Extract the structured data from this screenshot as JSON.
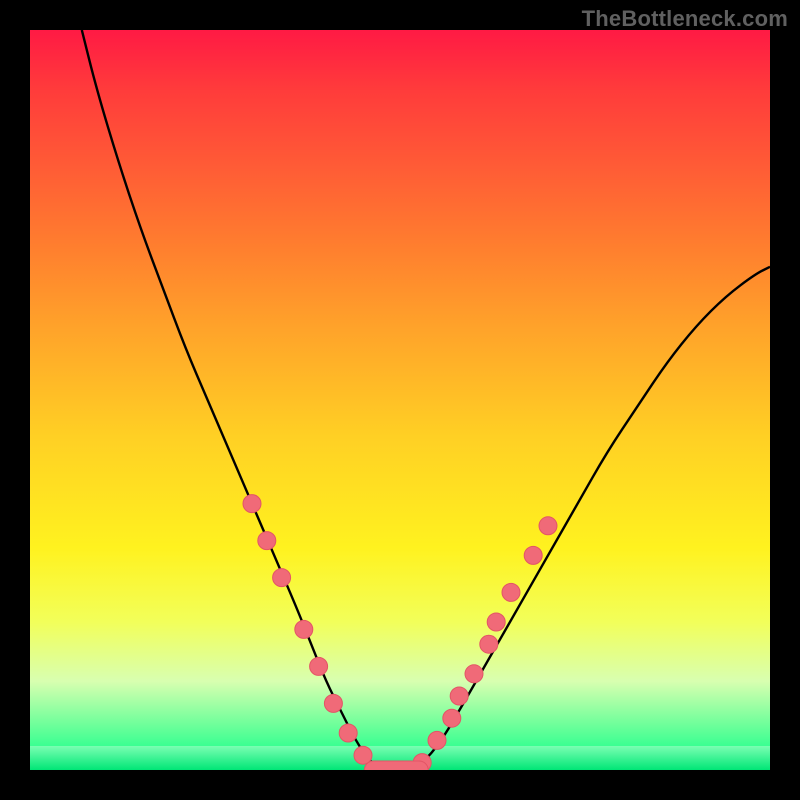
{
  "watermark": "TheBottleneck.com",
  "chart_data": {
    "type": "line",
    "title": "",
    "xlabel": "",
    "ylabel": "",
    "xlim": [
      0,
      100
    ],
    "ylim": [
      0,
      100
    ],
    "grid": false,
    "legend": false,
    "background_gradient": [
      "#ff1a44",
      "#ffd024",
      "#00ff88"
    ],
    "series": [
      {
        "name": "bottleneck-curve",
        "color": "#000000",
        "x": [
          7,
          9,
          12,
          15,
          18,
          21,
          24,
          27,
          30,
          33,
          36,
          38,
          40,
          42,
          44,
          46,
          48,
          50,
          52,
          55,
          58,
          62,
          66,
          70,
          74,
          78,
          82,
          86,
          90,
          94,
          98,
          100
        ],
        "y": [
          100,
          92,
          82,
          73,
          65,
          57,
          50,
          43,
          36,
          29,
          22,
          17,
          12,
          8,
          4,
          1,
          0,
          0,
          0,
          3,
          8,
          15,
          22,
          29,
          36,
          43,
          49,
          55,
          60,
          64,
          67,
          68
        ]
      }
    ],
    "markers": {
      "name": "highlight-points",
      "color": "#f06a78",
      "points": [
        {
          "x": 30,
          "y": 36
        },
        {
          "x": 32,
          "y": 31
        },
        {
          "x": 34,
          "y": 26
        },
        {
          "x": 37,
          "y": 19
        },
        {
          "x": 39,
          "y": 14
        },
        {
          "x": 41,
          "y": 9
        },
        {
          "x": 43,
          "y": 5
        },
        {
          "x": 45,
          "y": 2
        },
        {
          "x": 47,
          "y": 0
        },
        {
          "x": 49,
          "y": 0
        },
        {
          "x": 51,
          "y": 0
        },
        {
          "x": 53,
          "y": 1
        },
        {
          "x": 55,
          "y": 4
        },
        {
          "x": 57,
          "y": 7
        },
        {
          "x": 58,
          "y": 10
        },
        {
          "x": 60,
          "y": 13
        },
        {
          "x": 62,
          "y": 17
        },
        {
          "x": 63,
          "y": 20
        },
        {
          "x": 65,
          "y": 24
        },
        {
          "x": 68,
          "y": 29
        },
        {
          "x": 70,
          "y": 33
        }
      ]
    },
    "flat_region": {
      "x_start": 46,
      "x_end": 53,
      "y": 0
    }
  }
}
